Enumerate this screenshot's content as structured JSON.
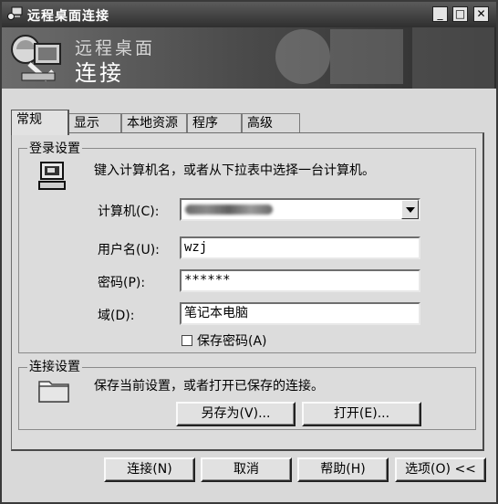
{
  "window": {
    "title": "远程桌面连接",
    "controls": {
      "minimize": "_",
      "maximize": "□",
      "close": "✕"
    }
  },
  "banner": {
    "subtitle": "远程桌面",
    "title": "连接"
  },
  "tabs": [
    "常规",
    "显示",
    "本地资源",
    "程序",
    "高级"
  ],
  "login": {
    "group_label": "登录设置",
    "instruction": "键入计算机名，或者从下拉表中选择一台计算机。",
    "computer_label": "计算机(C):",
    "username_label": "用户名(U):",
    "username_value": "wzj",
    "password_label": "密码(P):",
    "password_value": "******",
    "domain_label": "域(D):",
    "domain_value": "笔记本电脑",
    "save_password_label": "保存密码(A)"
  },
  "connection": {
    "group_label": "连接设置",
    "instruction": "保存当前设置，或者打开已保存的连接。",
    "save_as": "另存为(V)...",
    "open": "打开(E)..."
  },
  "footer": {
    "connect": "连接(N)",
    "cancel": "取消",
    "help": "帮助(H)",
    "options": "选项(O) <<"
  },
  "colors": {
    "titlebar": "#2f2f2f",
    "banner": "#4b4b4b",
    "dialog": "#d9d9d9"
  }
}
